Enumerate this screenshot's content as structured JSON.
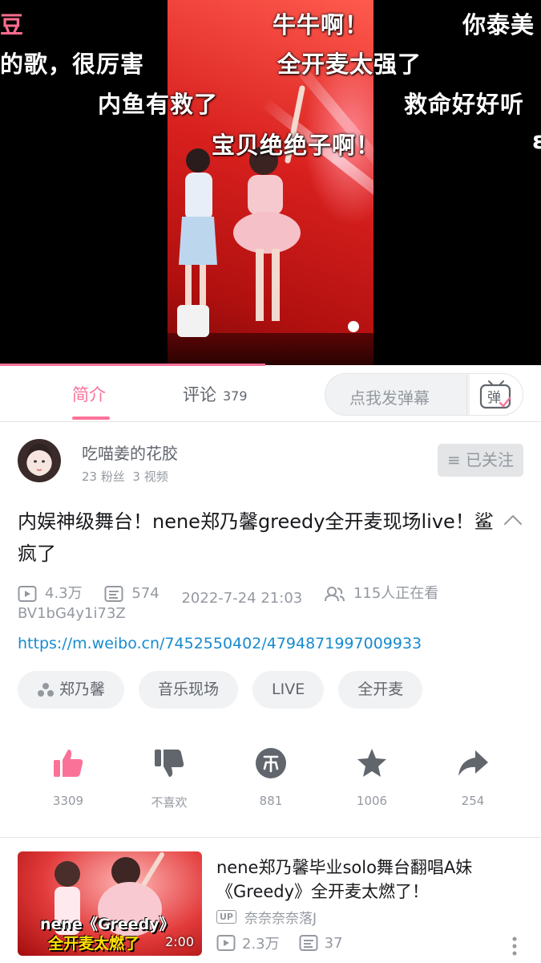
{
  "video": {
    "danmaku": [
      "豆",
      "牛牛啊！",
      "你泰美",
      "的歌，很厉害",
      "全开麦太强了",
      "内鱼有救了",
      "救命好好听",
      "宝贝绝绝子啊！",
      "ε"
    ],
    "progress": 0.49
  },
  "tabs": {
    "intro": "简介",
    "comments": "评论",
    "comments_count": "379",
    "danmaku_placeholder": "点我发弹幕",
    "danmaku_button": "弹"
  },
  "uploader": {
    "name": "吃喵姜的花胶",
    "fans": "23 粉丝",
    "videos": "3 视频",
    "follow_label": "≡ 已关注"
  },
  "video_info": {
    "title": "内娱神级舞台！nene郑乃馨greedy全开麦现场live！鲨疯了",
    "views": "4.3万",
    "danmaku_count": "574",
    "datetime": "2022-7-24 21:03",
    "watching": "115人正在看",
    "bvid": "BV1bG4y1i73Z",
    "link": "https://m.weibo.cn/7452550402/4794871997009933"
  },
  "tags": [
    "郑乃馨",
    "音乐现场",
    "LIVE",
    "全开麦"
  ],
  "actions": {
    "like": "3309",
    "dislike": "不喜欢",
    "coin": "881",
    "favorite": "1006",
    "share": "254"
  },
  "related": {
    "title": "nene郑乃馨毕业solo舞台翻唱A妹《Greedy》全开麦太燃了！",
    "thumb_caption_1": "nene《Greedy》",
    "thumb_caption_2": "全开麦太燃了",
    "duration": "2:00",
    "up_badge": "UP",
    "uploader": "奈奈奈奈落J",
    "views": "2.3万",
    "danmaku": "37"
  },
  "colors": {
    "accent": "#fb7299",
    "link": "#178bcf",
    "muted": "#9499a0"
  }
}
